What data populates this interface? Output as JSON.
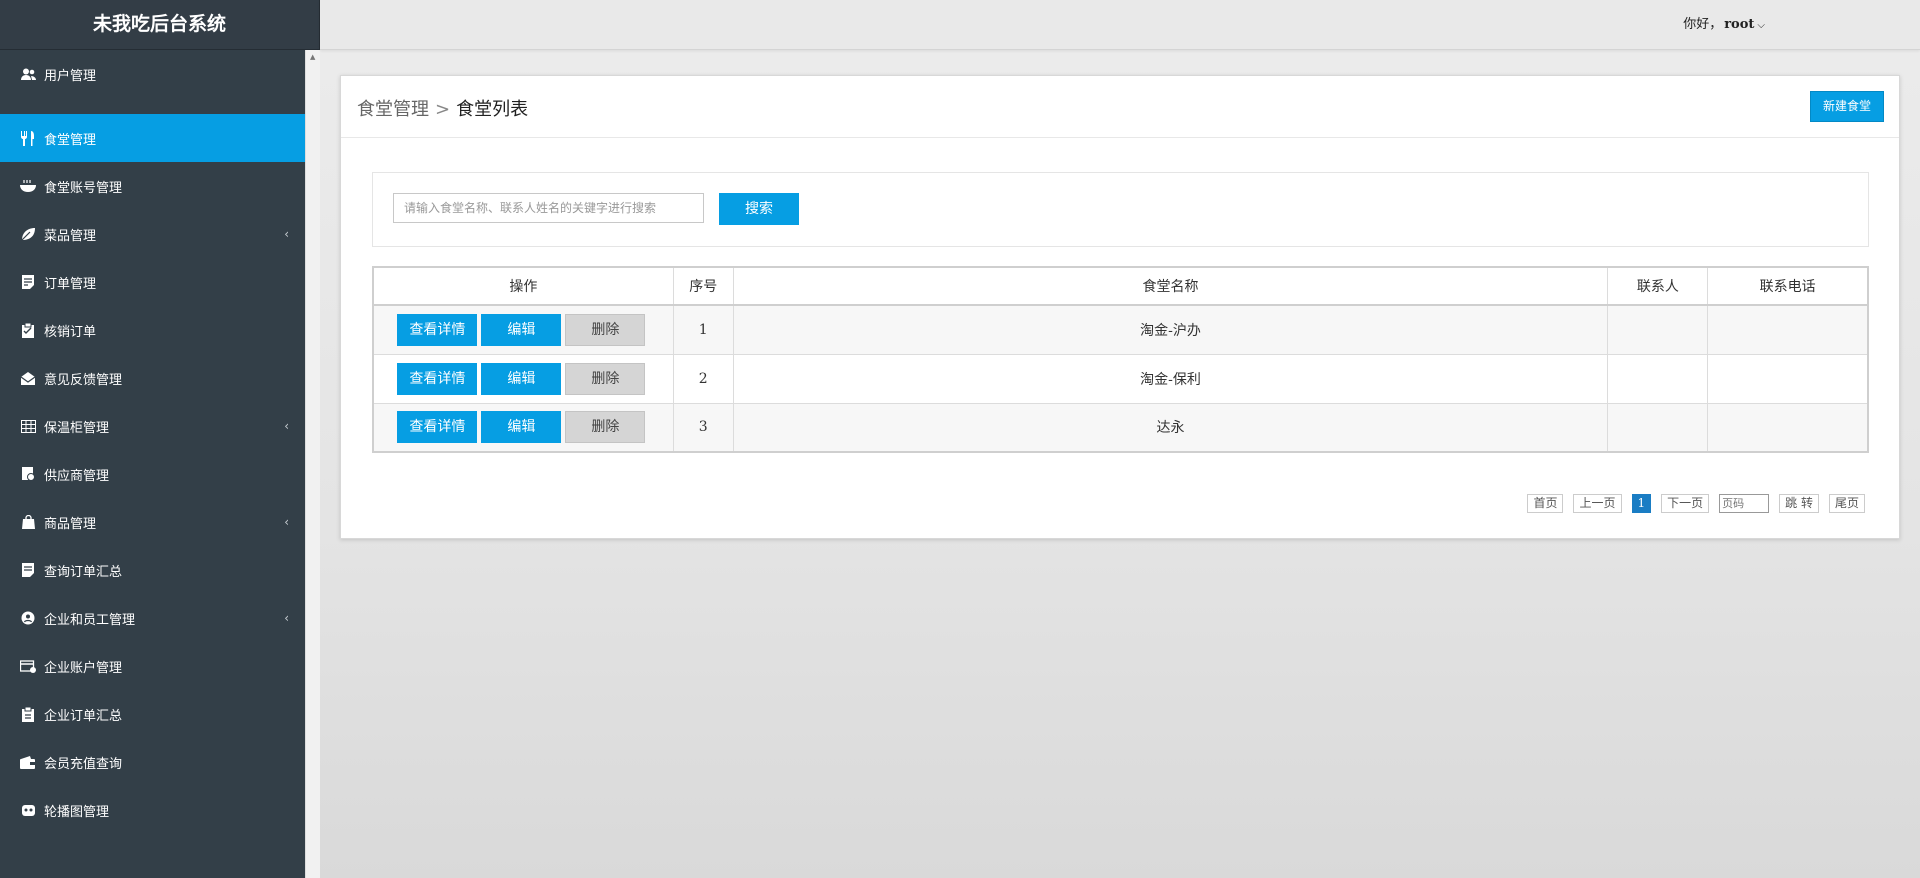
{
  "app": {
    "title": "未我吃后台系统"
  },
  "header": {
    "greeting": "你好，",
    "username": "root"
  },
  "sidebar": {
    "items": [
      {
        "label": "用户管理",
        "icon": "users-icon",
        "active": false,
        "submenu": false
      },
      {
        "label": "食堂管理",
        "icon": "fork-knife-icon",
        "active": true,
        "submenu": false
      },
      {
        "label": "食堂账号管理",
        "icon": "bowl-icon",
        "active": false,
        "submenu": false
      },
      {
        "label": "菜品管理",
        "icon": "leaf-icon",
        "active": false,
        "submenu": true
      },
      {
        "label": "订单管理",
        "icon": "order-doc-icon",
        "active": false,
        "submenu": false
      },
      {
        "label": "核销订单",
        "icon": "clipboard-check-icon",
        "active": false,
        "submenu": false
      },
      {
        "label": "意见反馈管理",
        "icon": "mail-icon",
        "active": false,
        "submenu": false
      },
      {
        "label": "保温柜管理",
        "icon": "grid-icon",
        "active": false,
        "submenu": true
      },
      {
        "label": "供应商管理",
        "icon": "supplier-icon",
        "active": false,
        "submenu": false
      },
      {
        "label": "商品管理",
        "icon": "bag-icon",
        "active": false,
        "submenu": true
      },
      {
        "label": "查询订单汇总",
        "icon": "report-icon",
        "active": false,
        "submenu": false
      },
      {
        "label": "企业和员工管理",
        "icon": "company-icon",
        "active": false,
        "submenu": true
      },
      {
        "label": "企业账户管理",
        "icon": "account-card-icon",
        "active": false,
        "submenu": false
      },
      {
        "label": "企业订单汇总",
        "icon": "summary-icon",
        "active": false,
        "submenu": false
      },
      {
        "label": "会员充值查询",
        "icon": "wallet-icon",
        "active": false,
        "submenu": false
      },
      {
        "label": "轮播图管理",
        "icon": "carousel-icon",
        "active": false,
        "submenu": false
      }
    ]
  },
  "main": {
    "breadcrumb": {
      "parent": "食堂管理",
      "separator": ">",
      "current": "食堂列表"
    },
    "new_button": "新建食堂",
    "search": {
      "placeholder": "请输入食堂名称、联系人姓名的关键字进行搜索",
      "value": "",
      "button": "搜索"
    },
    "table": {
      "headers": [
        "操作",
        "序号",
        "食堂名称",
        "联系人",
        "联系电话"
      ],
      "actions": {
        "view": "查看详情",
        "edit": "编辑",
        "delete": "删除"
      },
      "rows": [
        {
          "index": "1",
          "name": "淘金-沪办",
          "contact": "",
          "phone": ""
        },
        {
          "index": "2",
          "name": "淘金-保利",
          "contact": "",
          "phone": ""
        },
        {
          "index": "3",
          "name": "达永",
          "contact": "",
          "phone": ""
        }
      ]
    },
    "pager": {
      "first": "首页",
      "prev": "上一页",
      "current": "1",
      "next": "下一页",
      "input_placeholder": "页码",
      "jump": "跳 转",
      "last": "尾页"
    }
  },
  "colors": {
    "accent": "#069ee3",
    "sidebar_bg": "#333f48",
    "delete_btn": "#d5d5d5"
  }
}
